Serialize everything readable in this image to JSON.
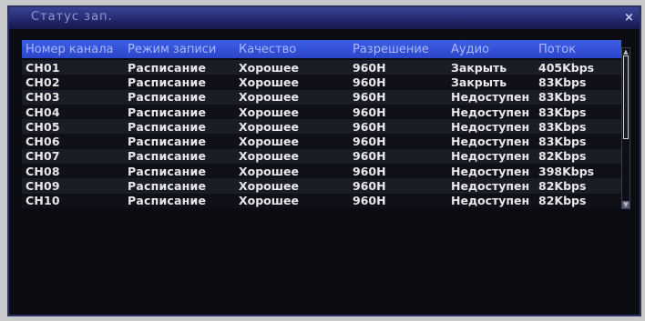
{
  "window": {
    "title": "Статус зап.",
    "close_glyph": "×"
  },
  "table": {
    "headers": [
      "Номер канала",
      "Режим записи",
      "Качество",
      "Разрешение",
      "Аудио",
      "Поток"
    ],
    "rows": [
      [
        "CH01",
        "Расписание",
        "Хорошее",
        "960H",
        "Закрыть",
        "405Kbps"
      ],
      [
        "CH02",
        "Расписание",
        "Хорошее",
        "960H",
        "Закрыть",
        "83Kbps"
      ],
      [
        "CH03",
        "Расписание",
        "Хорошее",
        "960H",
        "Недоступен",
        "83Kbps"
      ],
      [
        "CH04",
        "Расписание",
        "Хорошее",
        "960H",
        "Недоступен",
        "83Kbps"
      ],
      [
        "CH05",
        "Расписание",
        "Хорошее",
        "960H",
        "Недоступен",
        "83Kbps"
      ],
      [
        "CH06",
        "Расписание",
        "Хорошее",
        "960H",
        "Недоступен",
        "83Kbps"
      ],
      [
        "CH07",
        "Расписание",
        "Хорошее",
        "960H",
        "Недоступен",
        "82Kbps"
      ],
      [
        "CH08",
        "Расписание",
        "Хорошее",
        "960H",
        "Недоступен",
        "398Kbps"
      ],
      [
        "CH09",
        "Расписание",
        "Хорошее",
        "960H",
        "Недоступен",
        "82Kbps"
      ],
      [
        "CH10",
        "Расписание",
        "Хорошее",
        "960H",
        "Недоступен",
        "82Kbps"
      ]
    ]
  },
  "colors": {
    "titlebar": "#232a6e",
    "header_bg": "#3d5fe6",
    "header_text": "#aab8ff",
    "row_text": "#e8e8ec",
    "window_bg": "#0b0c12"
  },
  "icons": {
    "close": "close-icon",
    "scroll_up": "arrow-up-icon",
    "scroll_down": "arrow-down-icon"
  }
}
